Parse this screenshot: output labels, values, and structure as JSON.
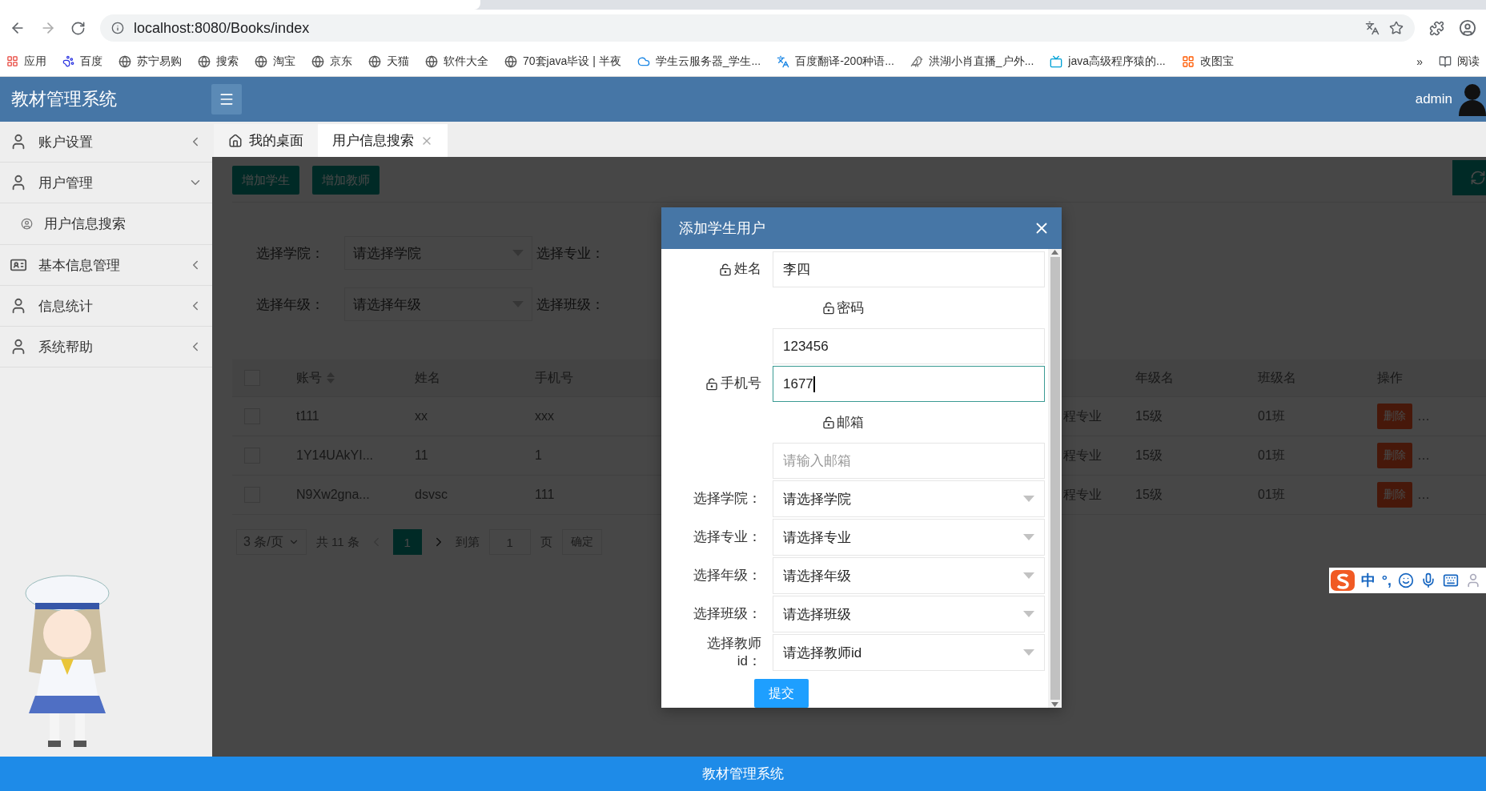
{
  "browser": {
    "url": "localhost:8080/Books/index",
    "bookmarks": [
      {
        "label": "应用",
        "kind": "apps"
      },
      {
        "label": "百度",
        "kind": "paw"
      },
      {
        "label": "苏宁易购",
        "kind": "globe"
      },
      {
        "label": "搜索",
        "kind": "globe"
      },
      {
        "label": "淘宝",
        "kind": "globe"
      },
      {
        "label": "京东",
        "kind": "globe"
      },
      {
        "label": "天猫",
        "kind": "globe"
      },
      {
        "label": "软件大全",
        "kind": "globe"
      },
      {
        "label": "70套java毕设 | 半夜",
        "kind": "globe"
      },
      {
        "label": "学生云服务器_学生...",
        "kind": "cloud"
      },
      {
        "label": "百度翻译-200种语...",
        "kind": "translate"
      },
      {
        "label": "洪湖小肖直播_户外...",
        "kind": "bird"
      },
      {
        "label": "java高级程序猿的...",
        "kind": "tv"
      },
      {
        "label": "改图宝",
        "kind": "squares"
      }
    ],
    "more": "»",
    "reading_list": "阅读"
  },
  "app": {
    "title": "教材管理系统",
    "user": "admin"
  },
  "sidebar": {
    "items": [
      {
        "label": "账户设置",
        "kind": "user",
        "expanded": false
      },
      {
        "label": "用户管理",
        "kind": "user",
        "expanded": true,
        "children": [
          {
            "label": "用户信息搜索"
          }
        ]
      },
      {
        "label": "基本信息管理",
        "kind": "card",
        "expanded": false
      },
      {
        "label": "信息统计",
        "kind": "user",
        "expanded": false
      },
      {
        "label": "系统帮助",
        "kind": "user",
        "expanded": false
      }
    ]
  },
  "tabs": [
    {
      "label": "我的桌面",
      "kind": "home",
      "selected": false
    },
    {
      "label": "用户信息搜索",
      "kind": "page",
      "selected": true
    }
  ],
  "toolbar": {
    "buttons": [
      "增加学生",
      "增加教师"
    ]
  },
  "filters": [
    {
      "label": "选择学院：",
      "placeholder": "请选择学院"
    },
    {
      "label": "选择专业："
    },
    {
      "label": "选择年级：",
      "placeholder": "请选择年级"
    },
    {
      "label": "选择班级："
    }
  ],
  "table": {
    "checked": false,
    "columns": {
      "account": "账号",
      "name": "姓名",
      "phone": "手机号",
      "grade": "年级名",
      "class": "班级名",
      "actions": "操作"
    },
    "rows": [
      {
        "checked": false,
        "account": "t111",
        "name": "xx",
        "phone": "xxx",
        "column_5": "程专业",
        "grade": "15级",
        "class": "01班",
        "delete": "删除",
        "more": "…"
      },
      {
        "checked": false,
        "account": "1Y14UAkYI...",
        "name": "11",
        "phone": "1",
        "column_5": "程专业",
        "grade": "15级",
        "class": "01班",
        "delete": "删除",
        "more": "…"
      },
      {
        "checked": false,
        "account": "N9Xw2gna...",
        "name": "dsvsc",
        "phone": "111",
        "column_5": "程专业",
        "grade": "15级",
        "class": "01班",
        "delete": "删除",
        "more": "…"
      }
    ]
  },
  "pagination": {
    "page_size": "3 条/页",
    "total": "共 11 条",
    "pages": [
      {
        "label": "1",
        "selected": true
      }
    ],
    "goto": "到第",
    "goto_value": "1",
    "page_unit": "页",
    "confirm": "确定"
  },
  "modal": {
    "title": "添加学生用户",
    "submit": "提交",
    "fields": [
      {
        "kind": "input",
        "label": "姓名",
        "label_above": false,
        "focused": false,
        "value": "李四"
      },
      {
        "kind": "input",
        "label": "密码",
        "label_above": true,
        "focused": false,
        "value": "123456"
      },
      {
        "kind": "input",
        "label": "手机号",
        "label_above": false,
        "focused": true,
        "value": "1677"
      },
      {
        "kind": "input",
        "label": "邮箱",
        "label_above": true,
        "focused": false,
        "placeholder": "请输入邮箱"
      },
      {
        "kind": "select",
        "label": "选择学院：",
        "placeholder": "请选择学院"
      },
      {
        "kind": "select",
        "label": "选择专业：",
        "placeholder": "请选择专业"
      },
      {
        "kind": "select",
        "label": "选择年级：",
        "placeholder": "请选择年级"
      },
      {
        "kind": "select",
        "label": "选择班级：",
        "placeholder": "请选择班级"
      },
      {
        "kind": "select",
        "label": "选择教师id：",
        "placeholder": "请选择教师id"
      }
    ]
  },
  "ime": {
    "lang": "中",
    "punct": "°,"
  },
  "footer": "教材管理系统"
}
